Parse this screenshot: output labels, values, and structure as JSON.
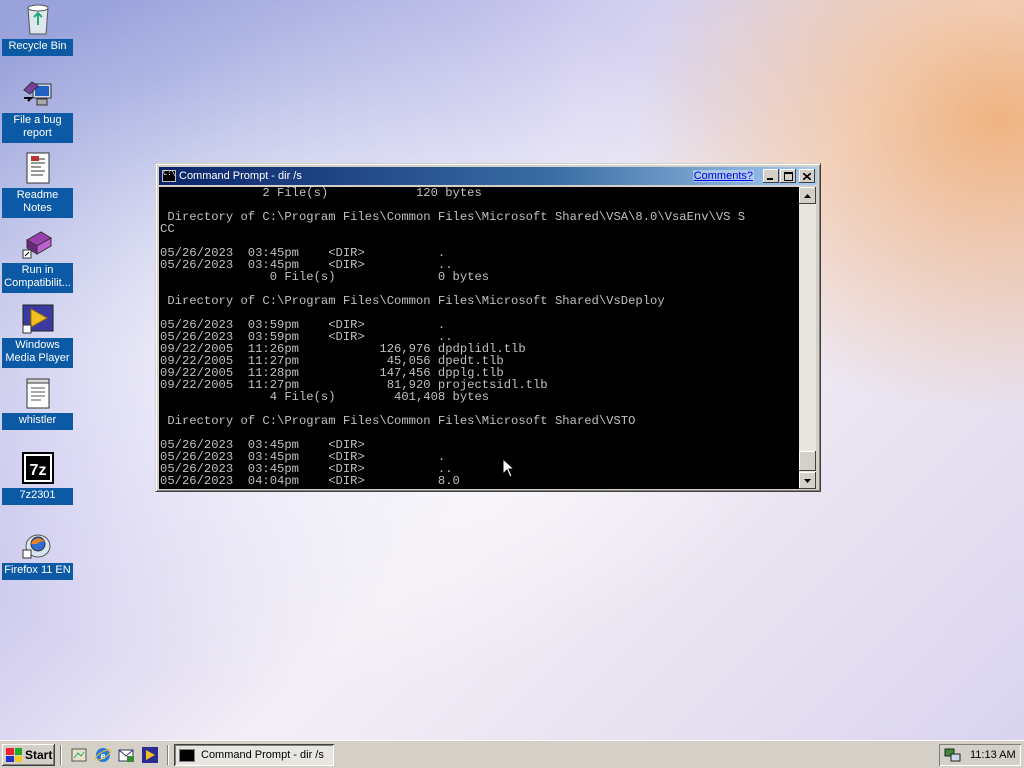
{
  "desktop": {
    "icons": [
      {
        "label": "Recycle Bin",
        "icon": "recycle-bin-icon"
      },
      {
        "label": "File a bug report",
        "icon": "bug-report-icon"
      },
      {
        "label": "Readme Notes",
        "icon": "readme-notes-icon"
      },
      {
        "label": "Run in Compatibilit...",
        "icon": "compatibility-icon"
      },
      {
        "label": "Windows Media Player",
        "icon": "media-player-icon"
      },
      {
        "label": "whistler",
        "icon": "text-file-icon"
      },
      {
        "label": "7z2301",
        "icon": "7zip-icon"
      },
      {
        "label": "Firefox 11 EN",
        "icon": "firefox-installer-icon"
      }
    ]
  },
  "window": {
    "title": "Command Prompt - dir /s",
    "comments_link": "Comments?",
    "console_lines": [
      "              2 File(s)            120 bytes",
      "",
      " Directory of C:\\Program Files\\Common Files\\Microsoft Shared\\VSA\\8.0\\VsaEnv\\VS S",
      "CC",
      "",
      "05/26/2023  03:45pm    <DIR>          .",
      "05/26/2023  03:45pm    <DIR>          ..",
      "               0 File(s)              0 bytes",
      "",
      " Directory of C:\\Program Files\\Common Files\\Microsoft Shared\\VsDeploy",
      "",
      "05/26/2023  03:59pm    <DIR>          .",
      "05/26/2023  03:59pm    <DIR>          ..",
      "09/22/2005  11:26pm           126,976 dpdplidl.tlb",
      "09/22/2005  11:27pm            45,056 dpedt.tlb",
      "09/22/2005  11:28pm           147,456 dpplg.tlb",
      "09/22/2005  11:27pm            81,920 projectsidl.tlb",
      "               4 File(s)        401,408 bytes",
      "",
      " Directory of C:\\Program Files\\Common Files\\Microsoft Shared\\VSTO",
      "",
      "05/26/2023  03:45pm    <DIR>",
      "05/26/2023  03:45pm    <DIR>          .",
      "05/26/2023  03:45pm    <DIR>          ..",
      "05/26/2023  04:04pm    <DIR>          8.0"
    ]
  },
  "taskbar": {
    "start_label": "Start",
    "task_label": "Command Prompt - dir /s",
    "clock": "11:13 AM",
    "quick_launch": [
      "show-desktop-icon",
      "internet-explorer-icon",
      "outlook-express-icon",
      "media-player-icon"
    ]
  }
}
